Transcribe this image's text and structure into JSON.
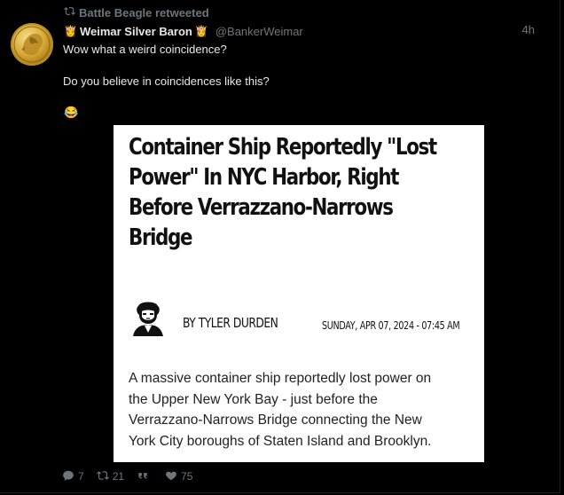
{
  "retweet": {
    "label": "Battle Beagle retweeted"
  },
  "author": {
    "display_name": "Weimar Silver Baron",
    "crown_left": "👸",
    "crown_right": "👸",
    "handle": "@BankerWeimar",
    "time": "4h"
  },
  "tweet": {
    "line1": "Wow what a weird coincidence?",
    "line2": "Do you believe in coincidences like this?",
    "emoji": "😂"
  },
  "article": {
    "headline_lines": [
      "Container Ship Reportedly \"Lost",
      "Power\" In NYC Harbor, Right",
      "Before Verrazzano-Narrows",
      "Bridge"
    ],
    "byline": "BY TYLER DURDEN",
    "date": "SUNDAY, APR 07, 2024 - 07:45 AM",
    "body_lines": [
      "A massive container ship reportedly lost power on",
      "the Upper New York Bay - just before the",
      "Verrazzano-Narrows Bridge connecting the New",
      "York City boroughs of Staten Island and Brooklyn."
    ]
  },
  "actions": {
    "replies": "7",
    "retweets": "21",
    "quotes": "",
    "likes": "75"
  },
  "colors": {
    "background": "#000000",
    "text": "#e7e9ea",
    "muted": "#6e767d"
  }
}
